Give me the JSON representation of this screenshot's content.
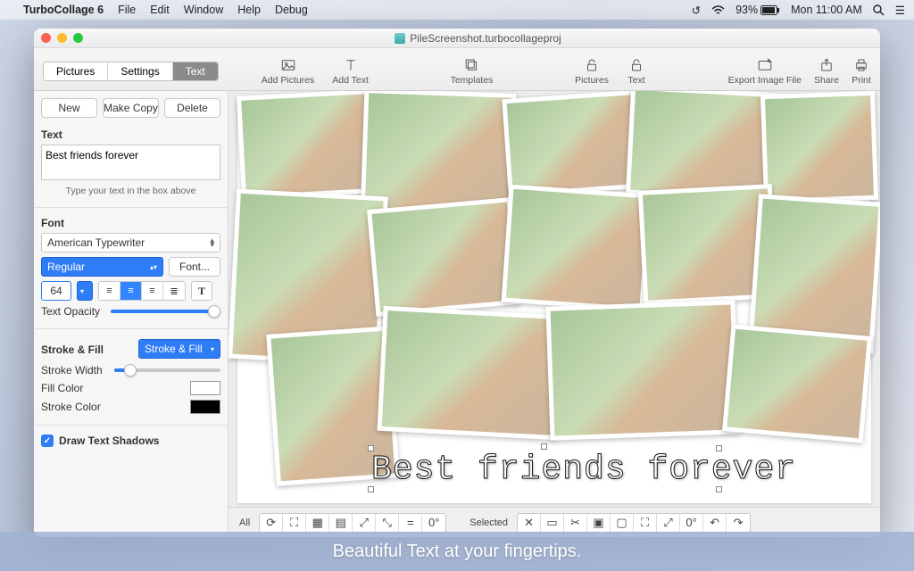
{
  "menubar": {
    "app_name": "TurboCollage 6",
    "items": [
      "File",
      "Edit",
      "Window",
      "Help",
      "Debug"
    ],
    "battery": "93%",
    "clock": "Mon 11:00 AM"
  },
  "window": {
    "doc_title": "PileScreenshot.turbocollageproj"
  },
  "segtabs": {
    "pictures": "Pictures",
    "settings": "Settings",
    "text": "Text"
  },
  "toolbar": {
    "add_pictures": "Add Pictures",
    "add_text": "Add Text",
    "templates": "Templates",
    "pictures": "Pictures",
    "text": "Text",
    "export": "Export Image File",
    "share": "Share",
    "print": "Print"
  },
  "sidebar": {
    "new_btn": "New",
    "make_copy_btn": "Make Copy",
    "delete_btn": "Delete",
    "text_label": "Text",
    "text_value": "Best friends forever",
    "text_hint": "Type your text in the box above",
    "font_label": "Font",
    "font_family": "American Typewriter",
    "font_weight": "Regular",
    "font_btn": "Font...",
    "font_size": "64",
    "text_opacity_label": "Text Opacity",
    "text_opacity_pct": 100,
    "stroke_fill_label": "Stroke & Fill",
    "stroke_fill_mode": "Stroke & Fill",
    "stroke_width_label": "Stroke Width",
    "stroke_width_pct": 15,
    "fill_color_label": "Fill Color",
    "stroke_color_label": "Stroke Color",
    "draw_shadows_label": "Draw Text Shadows"
  },
  "canvas": {
    "overlay_text": "Best friends forever"
  },
  "bottombar": {
    "all": "All",
    "selected": "Selected",
    "angle": "0°"
  },
  "caption": "Beautiful Text at your fingertips."
}
